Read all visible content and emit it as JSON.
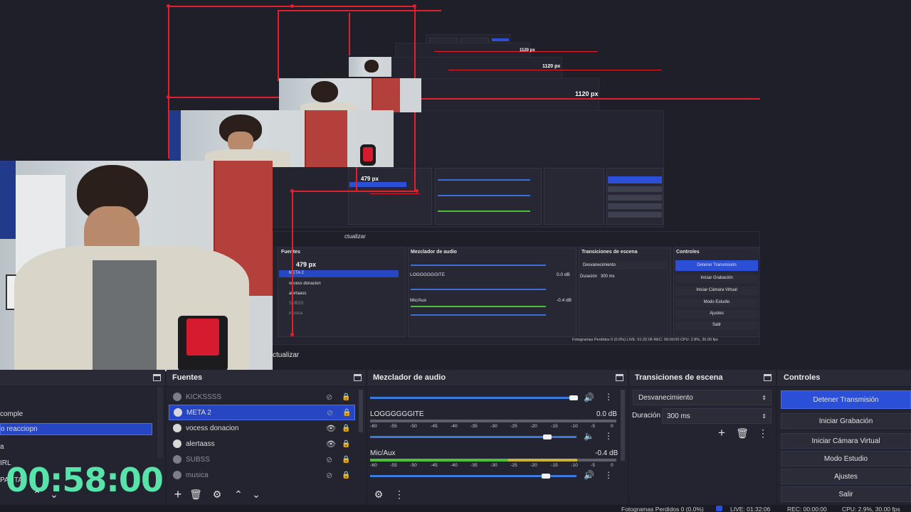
{
  "dimension_labels": [
    "1120 px",
    "1120 px",
    "1120 px",
    "479 px",
    "479 px"
  ],
  "mid_preview": {
    "panels": {
      "sources_title": "Fuentes",
      "mixer_title": "Mezclador de audio",
      "transitions_title": "Transiciones de escena",
      "controls_title": "Controles"
    },
    "sources": [
      "META 2",
      "vocess donacion",
      "alertaass",
      "SUBSS",
      "musica"
    ],
    "mixer": {
      "track1": "LOGGGGGGITE",
      "track1_db": "0.0 dB",
      "track2": "Mic/Aux",
      "track2_db": "-0.4 dB",
      "scale": "-60 -55 -50 -45 -40 -35 -30 -25 -20 -15 -10 -5 0"
    },
    "transition": {
      "name": "Desvanecimiento",
      "duration_label": "Duración",
      "duration": "300 ms"
    },
    "controls": [
      "Detener Transmisión",
      "Iniciar Grabación",
      "Iniciar Cámara Virtual",
      "Modo Estudio",
      "Ajustes",
      "Salir"
    ],
    "status": "Fotogramas Perdidos 0 (0.0%)   LIVE: 01:32:06   REC: 00:00:00   CPU: 2.8%, 30.00 fps",
    "actualizar": "ctualizar"
  },
  "main": {
    "actualizar_label": "ctualizar",
    "scenes": {
      "items": [
        "comple",
        "o reacciopn",
        "a",
        "IRL",
        "PANTA"
      ],
      "selected_index": 1,
      "timer": "00:58:00"
    },
    "sources": {
      "title": "Fuentes",
      "items": [
        {
          "label": "KICKSSSS",
          "visible": false,
          "selected": false
        },
        {
          "label": "META 2",
          "visible": false,
          "selected": true
        },
        {
          "label": "vocess donacion",
          "visible": true,
          "selected": false
        },
        {
          "label": "alertaass",
          "visible": true,
          "selected": false
        },
        {
          "label": "SUBSS",
          "visible": false,
          "selected": false
        },
        {
          "label": "musica",
          "visible": false,
          "selected": false
        }
      ]
    },
    "mixer": {
      "title": "Mezclador de audio",
      "tracks": [
        {
          "name": "LOGGGGGGITE",
          "db": "0.0 dB",
          "volume": 0.86
        },
        {
          "name": "Mic/Aux",
          "db": "-0.4 dB",
          "volume": 0.85
        }
      ],
      "scale": [
        "-60",
        "-55",
        "-50",
        "-45",
        "-40",
        "-35",
        "-30",
        "-25",
        "-20",
        "-15",
        "-10",
        "-5",
        "0"
      ]
    },
    "transitions": {
      "title": "Transiciones de escena",
      "selected": "Desvanecimiento",
      "duration_label": "Duración",
      "duration_value": "300 ms"
    },
    "controls": {
      "title": "Controles",
      "buttons": [
        "Detener Transmisión",
        "Iniciar Grabación",
        "Iniciar Cámara Virtual",
        "Modo Estudio",
        "Ajustes",
        "Salir"
      ]
    },
    "status": {
      "dropped": "Fotogramas Perdidos 0 (0.0%)",
      "live": "LIVE: 01:32:06",
      "rec": "REC: 00:00:00",
      "cpu": "CPU: 2.9%, 30.00 fps"
    }
  },
  "colors": {
    "accent": "#2b4fd6",
    "meter_green": "#4fbf3a",
    "meter_yellow": "#c8b43a",
    "timer": "#57e3a9",
    "guide_red": "#e0202c"
  }
}
